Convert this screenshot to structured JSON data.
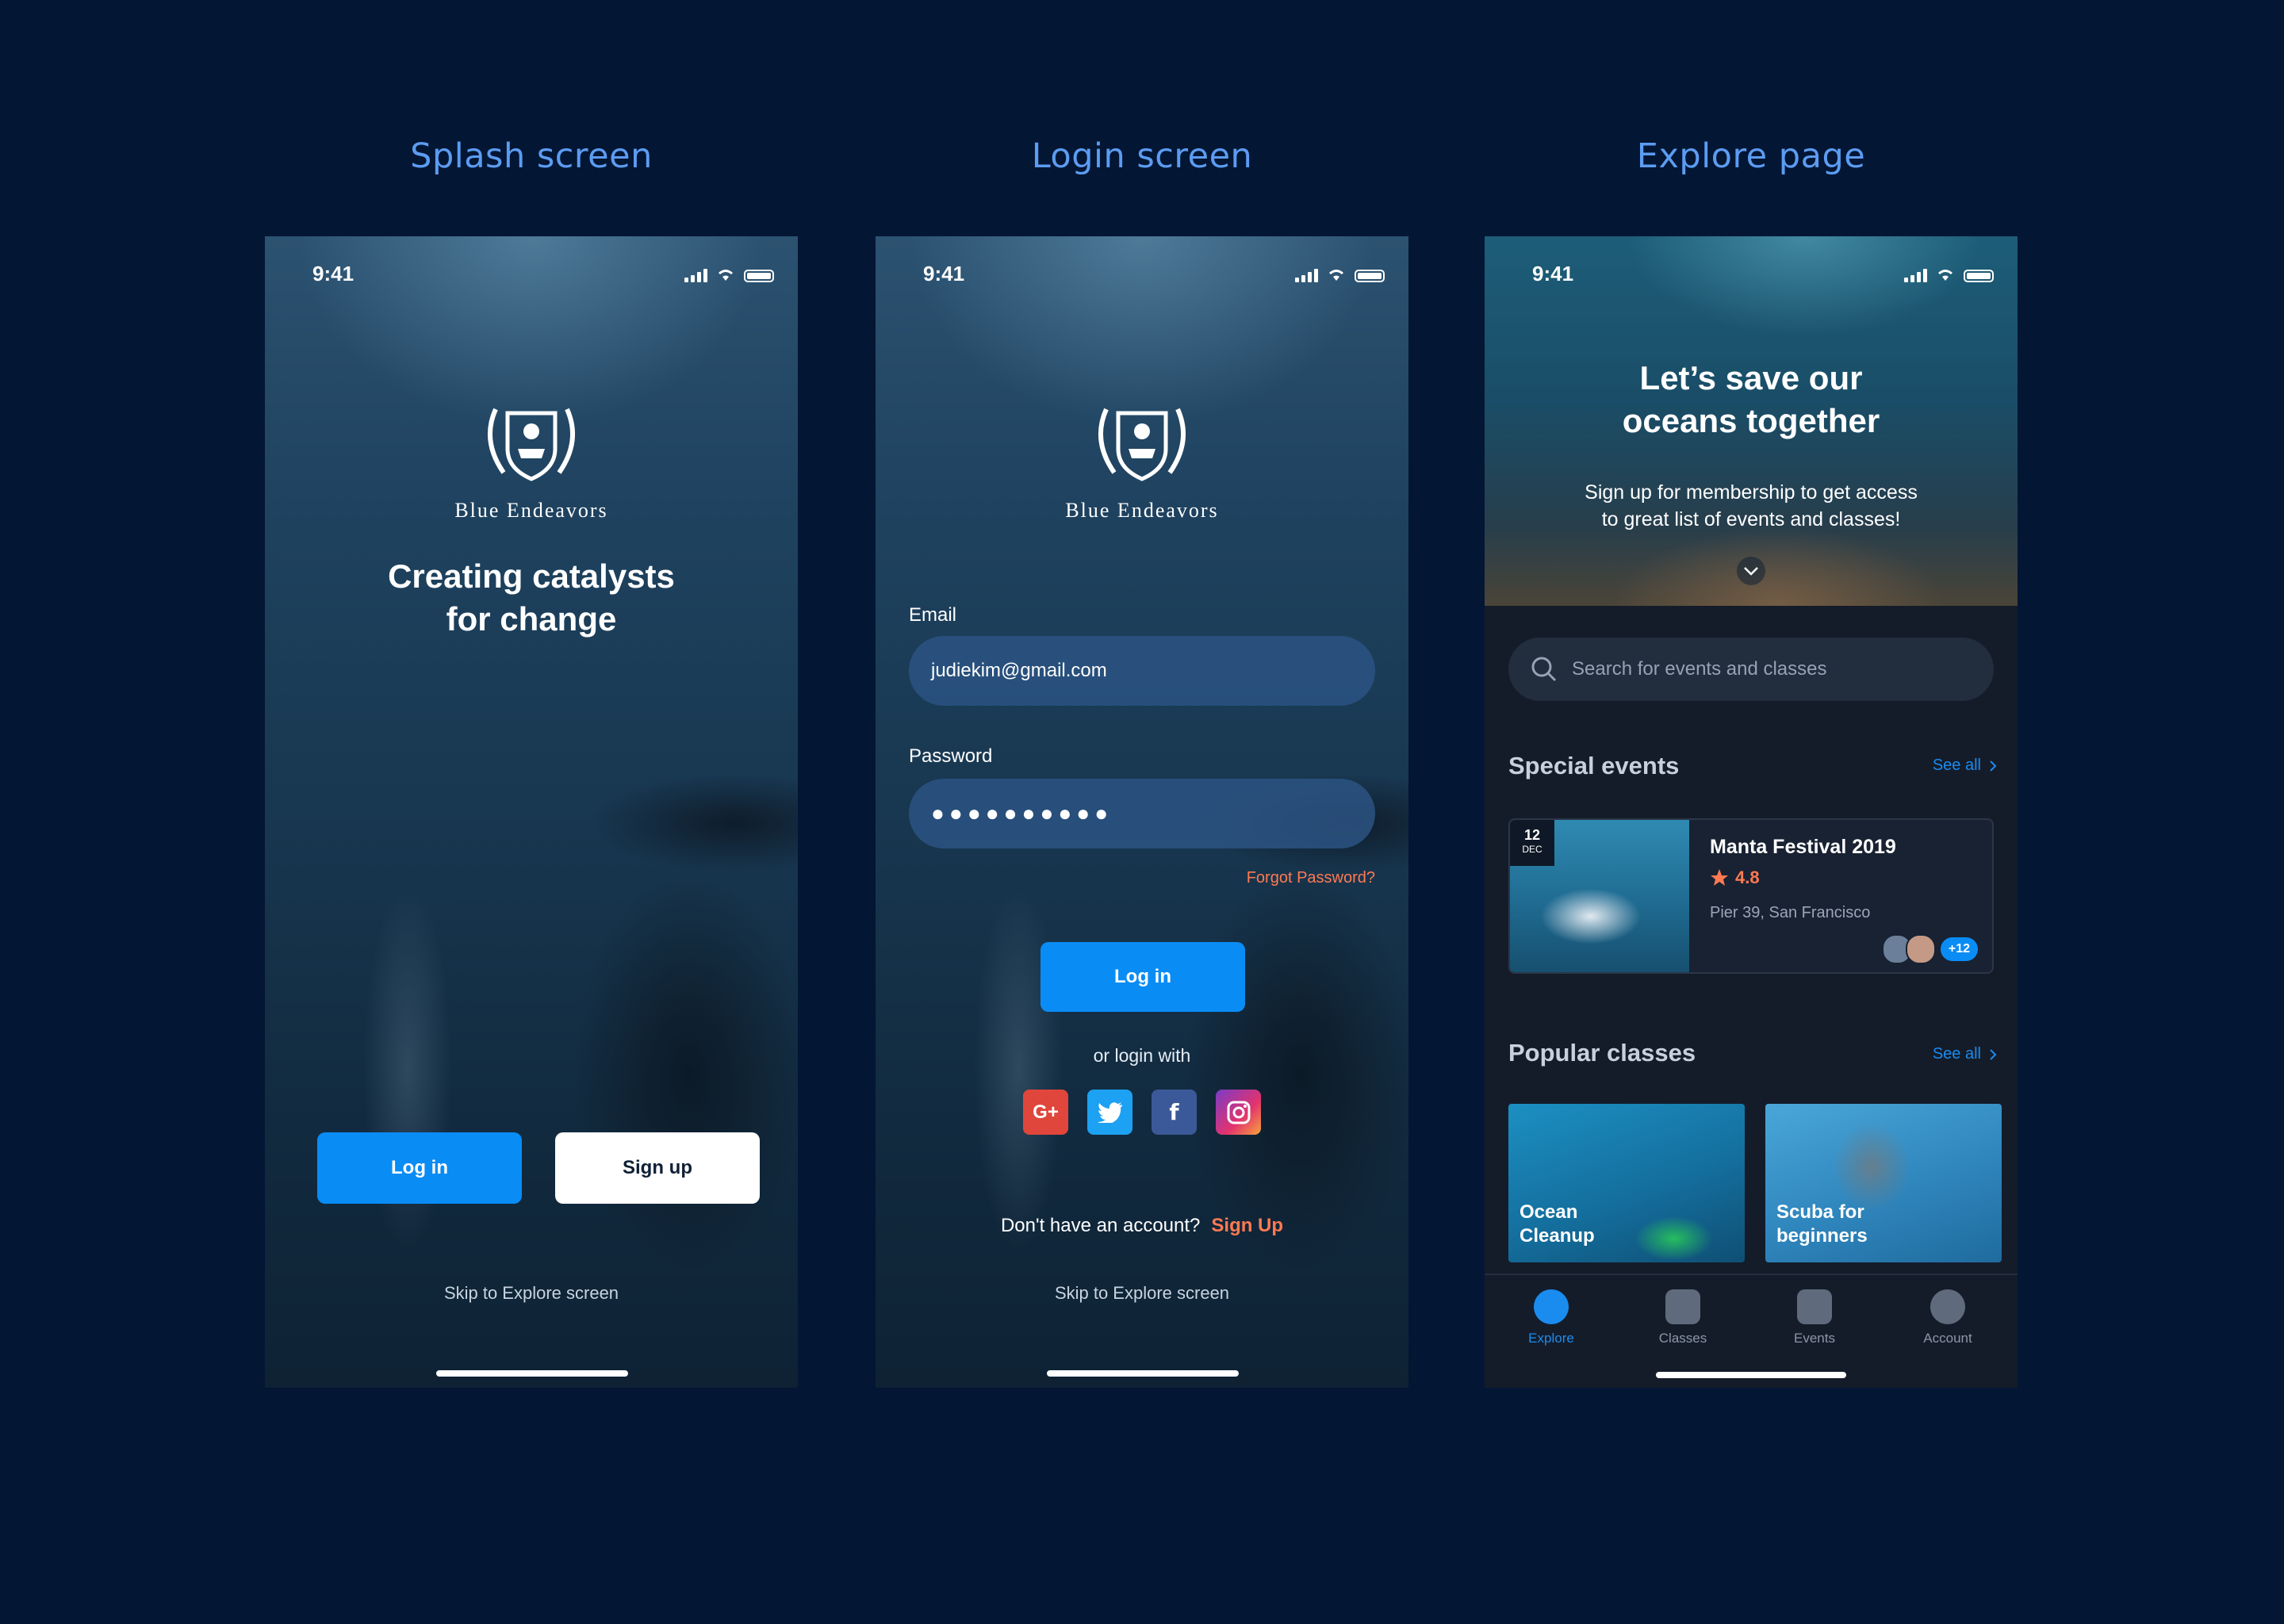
{
  "screen_titles": {
    "splash": "Splash screen",
    "login": "Login screen",
    "explore": "Explore page"
  },
  "status_time": "9:41",
  "brand": {
    "name": "Blue Endeavors"
  },
  "splash": {
    "headline_line1": "Creating catalysts",
    "headline_line2": "for change",
    "login_label": "Log in",
    "signup_label": "Sign up",
    "skip_label": "Skip to Explore screen"
  },
  "login": {
    "email_label": "Email",
    "email_value": "judiekim@gmail.com",
    "password_label": "Password",
    "password_mask": "●●●●●●●●●●",
    "forgot_label": "Forgot Password?",
    "login_label": "Log in",
    "or_label": "or login with",
    "socials": [
      "Google+",
      "Twitter",
      "Facebook",
      "Instagram"
    ],
    "no_account_label": "Don't have an account?",
    "signup_link": "Sign Up",
    "skip_label": "Skip to Explore screen"
  },
  "explore": {
    "hero_line1": "Let’s save our",
    "hero_line2": "oceans together",
    "hero_sub_line1": "Sign up for membership to get access",
    "hero_sub_line2": "to great list of events and classes!",
    "search_placeholder": "Search for events and classes",
    "special_events_title": "Special events",
    "see_all": "See all",
    "event": {
      "day": "12",
      "month": "DEC",
      "name": "Manta Festival 2019",
      "rating": "4.8",
      "place": "Pier 39, San Francisco",
      "extra_attendees": "+12"
    },
    "popular_classes_title": "Popular classes",
    "classes": [
      {
        "line1": "Ocean",
        "line2": "Cleanup"
      },
      {
        "line1": "Scuba for",
        "line2": "beginners"
      }
    ],
    "tabs": [
      "Explore",
      "Classes",
      "Events",
      "Account"
    ],
    "active_tab": "Explore"
  },
  "colors": {
    "background": "#031634",
    "title_accent": "#5c9cf2",
    "primary_button": "#0a8cf5",
    "link_orange": "#ff7a52"
  }
}
